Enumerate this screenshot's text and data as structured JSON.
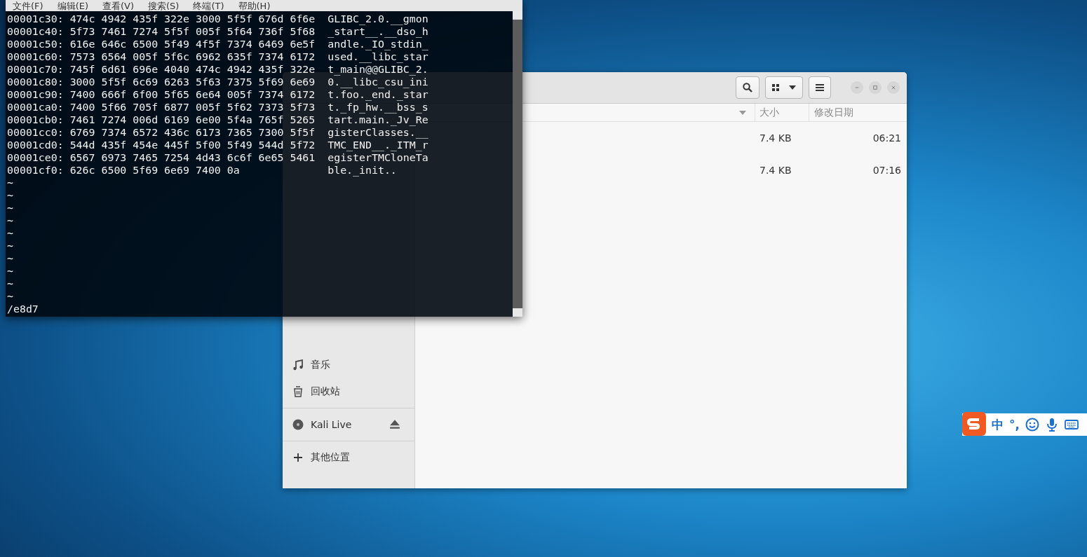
{
  "terminal": {
    "menu": [
      "文件(F)",
      "编辑(E)",
      "查看(V)",
      "搜索(S)",
      "终端(T)",
      "帮助(H)"
    ],
    "hex_lines": [
      "00001c30: 474c 4942 435f 322e 3000 5f5f 676d 6f6e  GLIBC_2.0.__gmon",
      "00001c40: 5f73 7461 7274 5f5f 005f 5f64 736f 5f68  _start__.__dso_h",
      "00001c50: 616e 646c 6500 5f49 4f5f 7374 6469 6e5f  andle._IO_stdin_",
      "00001c60: 7573 6564 005f 5f6c 6962 635f 7374 6172  used.__libc_star",
      "00001c70: 745f 6d61 696e 4040 474c 4942 435f 322e  t_main@@GLIBC_2.",
      "00001c80: 3000 5f5f 6c69 6263 5f63 7375 5f69 6e69  0.__libc_csu_ini",
      "00001c90: 7400 666f 6f00 5f65 6e64 005f 7374 6172  t.foo._end._star",
      "00001ca0: 7400 5f66 705f 6877 005f 5f62 7373 5f73  t._fp_hw.__bss_s",
      "00001cb0: 7461 7274 006d 6169 6e00 5f4a 765f 5265  tart.main._Jv_Re",
      "00001cc0: 6769 7374 6572 436c 6173 7365 7300 5f5f  gisterClasses.__",
      "00001cd0: 544d 435f 454e 445f 5f00 5f49 544d 5f72  TMC_END__._ITM_r",
      "00001ce0: 6567 6973 7465 7254 4d43 6c6f 6e65 5461  egisterTMCloneTa",
      "00001cf0: 626c 6500 5f69 6e69 7400 0a              ble._init.."
    ],
    "empty_lines": [
      "~",
      "~",
      "~",
      "~",
      "~",
      "~",
      "~",
      "~",
      "~",
      "~"
    ],
    "command_line": "/e8d7"
  },
  "file_manager": {
    "sidebar": [
      {
        "kind": "music",
        "label": "音乐"
      },
      {
        "kind": "trash",
        "label": "回收站"
      }
    ],
    "devices": [
      {
        "label": "Kali Live"
      }
    ],
    "other_locations": "其他位置",
    "columns": [
      "大小",
      "修改日期"
    ],
    "files": [
      {
        "size": "7.4 KB",
        "modified": "06:21"
      },
      {
        "size": "7.4 KB",
        "modified": "07:16"
      }
    ]
  },
  "input_method": {
    "mode": "中",
    "punctuation": "°,"
  }
}
